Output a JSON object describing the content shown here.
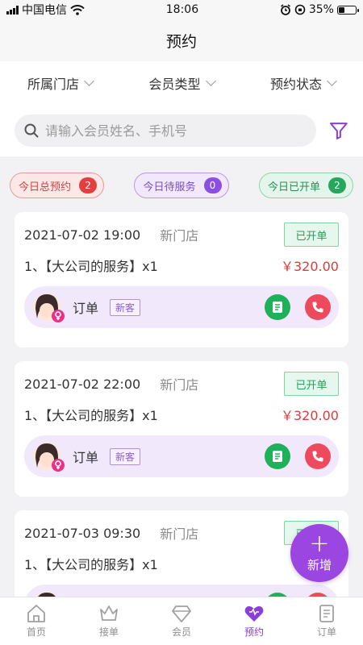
{
  "status_bar": {
    "carrier": "中国电信",
    "time": "18:06",
    "battery": "35%"
  },
  "title": "预约",
  "filters": [
    "所属门店",
    "会员类型",
    "预约状态"
  ],
  "search": {
    "placeholder": "请输入会员姓名、手机号"
  },
  "summary": [
    {
      "label": "今日总预约",
      "count": "2"
    },
    {
      "label": "今日待服务",
      "count": "0"
    },
    {
      "label": "今日已开单",
      "count": "2"
    }
  ],
  "appointments": [
    {
      "datetime": "2021-07-02 19:00",
      "store": "新门店",
      "status": "已开单",
      "service": "1、【大公司的服务】x1",
      "price": "￥320.00",
      "order": "订单",
      "tag": "新客"
    },
    {
      "datetime": "2021-07-02 22:00",
      "store": "新门店",
      "status": "已开单",
      "service": "1、【大公司的服务】x1",
      "price": "￥320.00",
      "order": "订单",
      "tag": "新客"
    },
    {
      "datetime": "2021-07-03 09:30",
      "store": "新门店",
      "status": "已开单",
      "service": "1、【大公司的服务】x1",
      "price": "￥",
      "order": "",
      "tag": ""
    }
  ],
  "fab": {
    "symbol": "+",
    "label": "新增"
  },
  "tabs": [
    {
      "label": "首页",
      "icon": "home-icon"
    },
    {
      "label": "接单",
      "icon": "crown-icon"
    },
    {
      "label": "会员",
      "icon": "diamond-icon"
    },
    {
      "label": "预约",
      "icon": "heart-icon"
    },
    {
      "label": "订单",
      "icon": "document-icon"
    }
  ],
  "colors": {
    "accent": "#8a3fd6",
    "price": "#e03a3a",
    "status_green": "#2a9d58"
  }
}
